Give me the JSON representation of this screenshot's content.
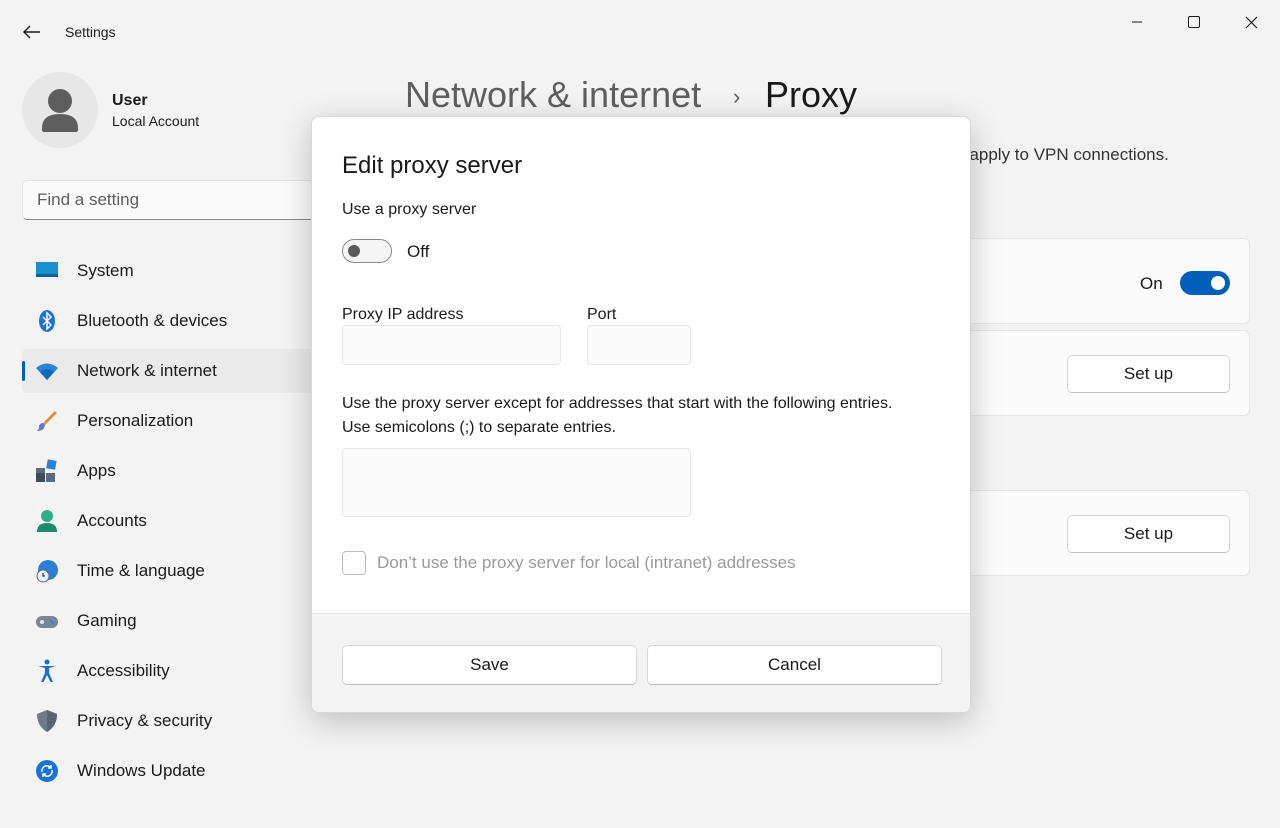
{
  "window": {
    "title": "Settings",
    "back_icon": "back-arrow-icon",
    "minimize_icon": "minimize-icon",
    "maximize_icon": "maximize-icon",
    "close_icon": "close-icon"
  },
  "profile": {
    "name": "User",
    "account_type": "Local Account"
  },
  "search": {
    "placeholder": "Find a setting"
  },
  "sidebar": {
    "items": [
      {
        "label": "System",
        "icon": "system-icon",
        "active": false
      },
      {
        "label": "Bluetooth & devices",
        "icon": "bluetooth-icon",
        "active": false
      },
      {
        "label": "Network & internet",
        "icon": "wifi-icon",
        "active": true
      },
      {
        "label": "Personalization",
        "icon": "brush-icon",
        "active": false
      },
      {
        "label": "Apps",
        "icon": "apps-icon",
        "active": false
      },
      {
        "label": "Accounts",
        "icon": "accounts-icon",
        "active": false
      },
      {
        "label": "Time & language",
        "icon": "time-language-icon",
        "active": false
      },
      {
        "label": "Gaming",
        "icon": "gamepad-icon",
        "active": false
      },
      {
        "label": "Accessibility",
        "icon": "accessibility-icon",
        "active": false
      },
      {
        "label": "Privacy & security",
        "icon": "shield-icon",
        "active": false
      },
      {
        "label": "Windows Update",
        "icon": "update-icon",
        "active": false
      }
    ]
  },
  "header": {
    "breadcrumb_parent": "Network & internet",
    "breadcrumb_separator": "›",
    "breadcrumb_current": "Proxy",
    "description_visible": "t apply to VPN connections."
  },
  "background_cards": {
    "auto_detect_state": "On",
    "setup_script_button": "Set up",
    "manual_setup_button": "Set up"
  },
  "dialog": {
    "title": "Edit proxy server",
    "use_proxy_label": "Use a proxy server",
    "use_proxy_state": "Off",
    "proxy_ip_label": "Proxy IP address",
    "proxy_ip_value": "",
    "port_label": "Port",
    "port_value": "",
    "exceptions_line1": "Use the proxy server except for addresses that start with the following entries.",
    "exceptions_line2": "Use semicolons (;) to separate entries.",
    "exceptions_value": "",
    "local_bypass_label": "Don’t use the proxy server for local (intranet) addresses",
    "local_bypass_checked": false,
    "save_label": "Save",
    "cancel_label": "Cancel"
  },
  "colors": {
    "accent": "#005fb8",
    "window_bg": "#f3f3f3",
    "dialog_bg": "#ffffff"
  }
}
